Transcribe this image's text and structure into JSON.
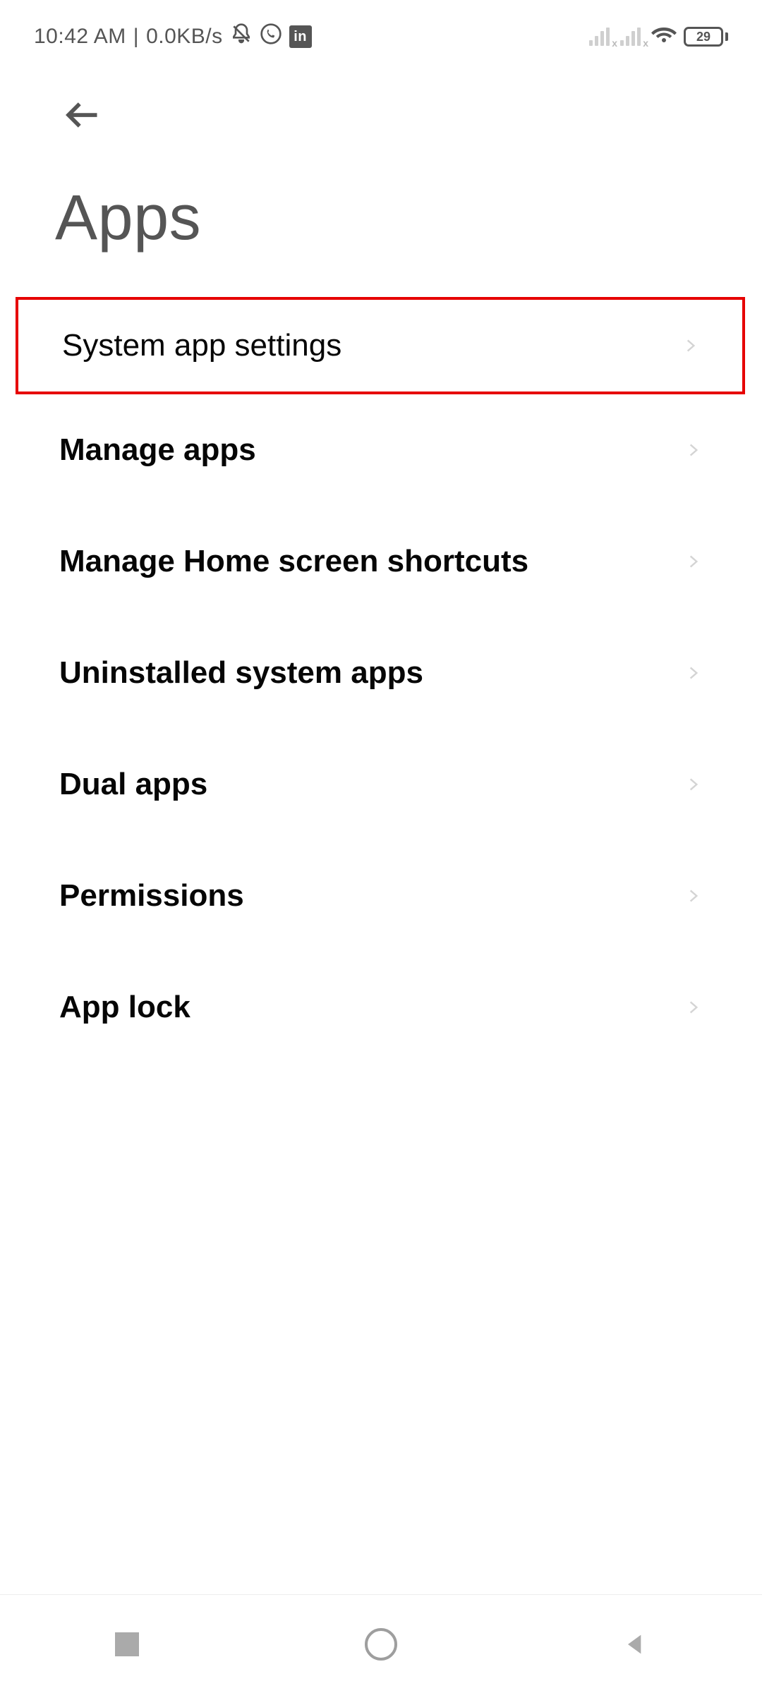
{
  "status": {
    "time": "10:42 AM",
    "sep": "|",
    "net_speed": "0.0KB/s",
    "battery": "29"
  },
  "header": {
    "title": "Apps"
  },
  "items": [
    {
      "label": "System app settings",
      "highlighted": true
    },
    {
      "label": "Manage apps"
    },
    {
      "label": "Manage Home screen shortcuts"
    },
    {
      "label": "Uninstalled system apps"
    },
    {
      "label": "Dual apps"
    },
    {
      "label": "Permissions"
    },
    {
      "label": "App lock"
    }
  ]
}
